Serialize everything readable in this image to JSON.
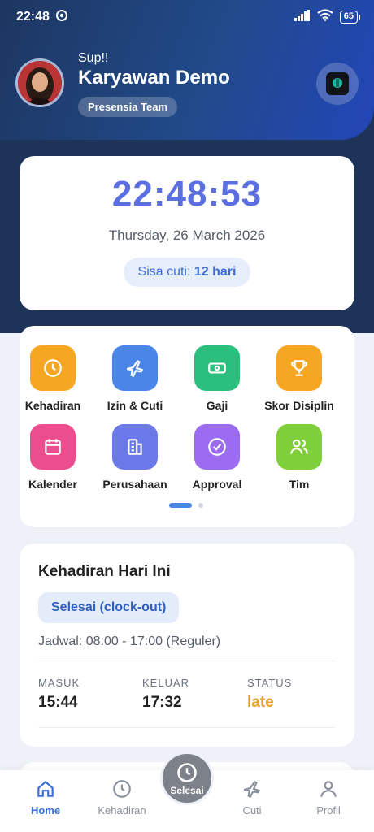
{
  "status_bar": {
    "time": "22:48",
    "battery": "65"
  },
  "profile": {
    "greeting": "Sup!!",
    "name": "Karyawan Demo",
    "team": "Presensia Team"
  },
  "clock": {
    "time": "22:48:53",
    "date": "Thursday, 26 March 2026",
    "leave_label": "Sisa cuti:",
    "leave_value": "12 hari"
  },
  "menu": {
    "items": [
      {
        "label": "Kehadiran",
        "icon": "clock-icon",
        "color": "#f5a623"
      },
      {
        "label": "Izin & Cuti",
        "icon": "plane-icon",
        "color": "#4a86e8"
      },
      {
        "label": "Gaji",
        "icon": "money-icon",
        "color": "#2bbf7e"
      },
      {
        "label": "Skor Disiplin",
        "icon": "trophy-icon",
        "color": "#f5a623"
      },
      {
        "label": "Kalender",
        "icon": "calendar-icon",
        "color": "#ec4d8f"
      },
      {
        "label": "Perusahaan",
        "icon": "building-icon",
        "color": "#6a78e8"
      },
      {
        "label": "Approval",
        "icon": "check-circle-icon",
        "color": "#9b6bf0"
      },
      {
        "label": "Tim",
        "icon": "users-icon",
        "color": "#7fcf3a"
      }
    ],
    "page_indicator": {
      "pages": 2,
      "active": 1
    }
  },
  "attendance": {
    "title": "Kehadiran Hari Ini",
    "status_chip": "Selesai (clock-out)",
    "schedule": "Jadwal: 08:00 - 17:00 (Reguler)",
    "masuk_label": "MASUK",
    "masuk_value": "15:44",
    "keluar_label": "KELUAR",
    "keluar_value": "17:32",
    "status_label": "STATUS",
    "status_value": "late"
  },
  "bottom_nav": {
    "home": "Home",
    "kehadiran": "Kehadiran",
    "fab": "Selesai",
    "cuti": "Cuti",
    "profil": "Profil",
    "active": "Home"
  },
  "colors": {
    "accent": "#3b6fd8",
    "header_dark": "#1e3358",
    "late": "#e8a020"
  }
}
